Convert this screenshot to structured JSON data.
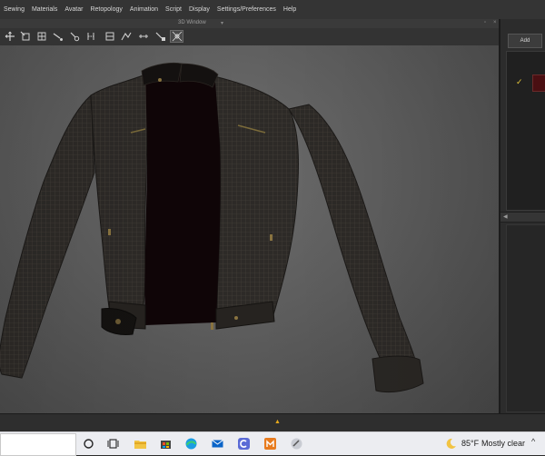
{
  "menubar": {
    "items": [
      "Sewing",
      "Materials",
      "Avatar",
      "Retopology",
      "Animation",
      "Script",
      "Display",
      "Settings/Preferences",
      "Help"
    ]
  },
  "window": {
    "title": "3D Window",
    "ctrl_left": "▾",
    "ctrl_right1": "▫",
    "ctrl_right2": "×"
  },
  "toolbar": {
    "tools": [
      {
        "icon": "select-move-icon"
      },
      {
        "icon": "transform-pin-icon"
      },
      {
        "icon": "select-mesh-icon"
      },
      {
        "icon": "pin-box-icon"
      },
      {
        "icon": "pin-tool-icon"
      },
      {
        "icon": "tack-icon"
      },
      {
        "icon": "fold-arrange-icon"
      },
      {
        "icon": "strengthen-icon"
      },
      {
        "icon": "measure-icon"
      },
      {
        "icon": "tape-icon"
      },
      {
        "icon": "selected-grid-icon"
      }
    ]
  },
  "right_panel": {
    "add_label": "Add",
    "check": "✓",
    "swatch_color": "#4a0f12",
    "split_arrow": "◀"
  },
  "bottom": {
    "collapse_arrow": "▲"
  },
  "taskbar": {
    "icons": [
      "start-cortana-icon",
      "task-view-icon",
      "file-explorer-icon",
      "store-icon",
      "edge-icon",
      "mail-icon",
      "app-c-icon",
      "marvelous-designer-icon",
      "app-tool-icon"
    ],
    "temperature": "85°F",
    "condition": "Mostly clear",
    "chevron": "^"
  },
  "colors": {
    "accent_yellow": "#e4c53a",
    "viewport_bg": "#5f5f5f",
    "jacket": "#2f2c29",
    "shirt": "#0f0507"
  }
}
